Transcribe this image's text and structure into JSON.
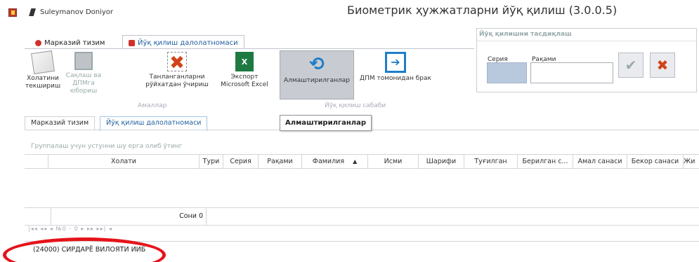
{
  "window": {
    "user": "Suleymanov Doniyor",
    "title": "Биометрик ҳужжатларни йўқ қилиш (3.0.0.5)"
  },
  "ribbon": {
    "tabs": [
      {
        "label": "Марказий тизим"
      },
      {
        "label": "Йўқ қилиш далолатномаси"
      }
    ],
    "buttons": [
      {
        "label": "Холатини текшириш",
        "icon": "check-document-icon"
      },
      {
        "label": "Сақлаш ва ДПМга юбориш",
        "icon": "save-icon"
      },
      {
        "label": "Танланганларни рўйхатдан ўчириш",
        "icon": "delete-icon"
      },
      {
        "label": "Экспорт Microsoft Excel",
        "icon": "excel-icon"
      },
      {
        "label": "Алмаштирилганлар",
        "icon": "replace-icon"
      },
      {
        "label": "ДПМ томонидан брак",
        "icon": "reject-icon"
      }
    ],
    "groups": {
      "actions": "Амаллар",
      "reason": "Йўқ қилиш сабаби"
    }
  },
  "confirm_panel": {
    "title": "Йўқ қилишни тасдиқлаш",
    "seria_label": "Серия",
    "rakami_label": "Рақами",
    "seria_value": "",
    "rakami_value": ""
  },
  "main_tabs": [
    {
      "label": "Марказий тизим"
    },
    {
      "label": "Йўқ қилиш далолатномаси"
    }
  ],
  "tooltip": "Алмаштирилганлар",
  "grid": {
    "group_hint": "Группалаш учун устунни шу ерга олиб ўтинг",
    "columns": [
      "Холати",
      "Тури",
      "Серия",
      "Рақами",
      "Фамилия",
      "Исми",
      "Шарифи",
      "Туғилган",
      "Берилган с...",
      "Амал санаси",
      "Бекор санаси",
      "Жи"
    ],
    "count": "Сони 0",
    "pager": "|◂◂ ◂◂ ◂ №0 - 0 ▸ ▸▸ ▸▸| ◂"
  },
  "status": "(24000) СИРДАРЁ ВИЛОЯТИ ИИБ",
  "colors": {
    "highlight": "#e5141b",
    "accent": "#1f5f9e"
  }
}
